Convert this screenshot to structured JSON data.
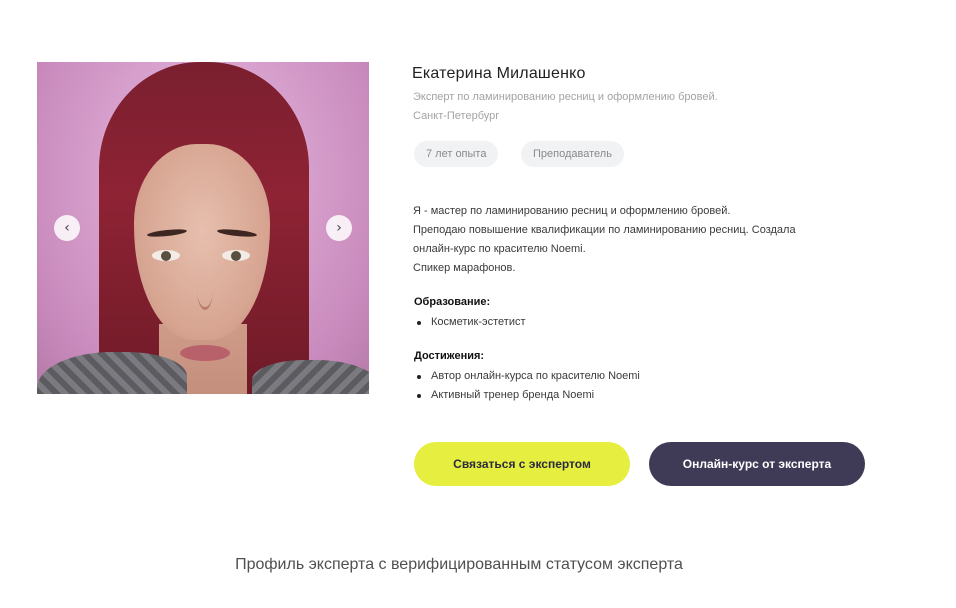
{
  "expert": {
    "name": "Екатерина Милашенко",
    "subtitle": "Эксперт по ламинированию ресниц и оформлению бровей.",
    "city": "Санкт-Петербург",
    "tags": [
      "7 лет опыта",
      "Преподаватель"
    ],
    "bio": [
      "Я - мастер по ламинированию ресниц и оформлению бровей.",
      "Преподаю повышение квалификации по ламинированию ресниц. Создала",
      "онлайн-курс по красителю Noemi.",
      "Спикер марафонов."
    ],
    "education": {
      "title": "Образование:",
      "items": [
        "Косметик-эстетист"
      ]
    },
    "achievements": {
      "title": "Достижения:",
      "items": [
        "Автор онлайн-курса по красителю Noemi",
        "Активный тренер бренда Noemi"
      ]
    }
  },
  "gallery": {
    "prev_icon": "‹",
    "next_icon": "›"
  },
  "buttons": {
    "contact_label": "Связаться с экспертом",
    "course_label": "Онлайн-курс от эксперта"
  },
  "colors": {
    "contact_button": "#e6ef3f",
    "course_button": "#3f3a56"
  },
  "caption": "Профиль эксперта с верифицированным статусом эксперта"
}
